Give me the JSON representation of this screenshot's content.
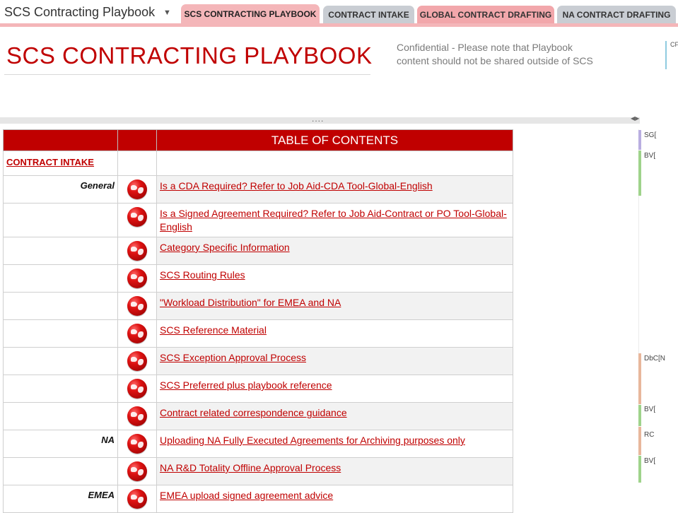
{
  "notebook": {
    "title": "SCS Contracting Playbook"
  },
  "tabs": [
    {
      "label": "SCS CONTRACTING PLAYBOOK"
    },
    {
      "label": "CONTRACT INTAKE"
    },
    {
      "label": "GLOBAL CONTRACT DRAFTING"
    },
    {
      "label": "NA CONTRACT DRAFTING"
    }
  ],
  "page": {
    "title": "SCS CONTRACTING PLAYBOOK",
    "confidential_line1": "Confidential - Please note that Playbook",
    "confidential_line2": "content should not be shared outside of SCS",
    "right_note": "CF"
  },
  "margin_tags": [
    "SG[",
    "BV[",
    "DbC[N",
    "BV[",
    "RC",
    "BV["
  ],
  "colors": {
    "accent": "#c00000",
    "tab_band": "#f4b6b9"
  },
  "toc": {
    "header": "TABLE OF CONTENTS",
    "section": "CONTRACT INTAKE",
    "rows": [
      {
        "category": "General",
        "link": "Is a CDA Required? Refer to Job Aid-CDA Tool-Global-English",
        "icon": "globe-icon"
      },
      {
        "category": "",
        "link": "Is a Signed Agreement Required? Refer to Job Aid-Contract or PO Tool-Global-English",
        "icon": "globe-icon"
      },
      {
        "category": "",
        "link": "Category Specific Information",
        "icon": "globe-icon"
      },
      {
        "category": "",
        "link": "SCS Routing Rules",
        "icon": "globe-icon"
      },
      {
        "category": "",
        "link": "\"Workload Distribution\" for EMEA and NA",
        "icon": "globe-icon"
      },
      {
        "category": "",
        "link": "SCS Reference Material",
        "icon": "globe-icon"
      },
      {
        "category": "",
        "link": "SCS Exception Approval Process",
        "icon": "globe-icon"
      },
      {
        "category": "",
        "link": "SCS Preferred plus playbook reference",
        "icon": "globe-icon"
      },
      {
        "category": "",
        "link": "Contract related correspondence guidance",
        "icon": "globe-icon"
      },
      {
        "category": "NA",
        "link": "Uploading NA Fully Executed Agreements for Archiving purposes only",
        "icon": "globe-icon"
      },
      {
        "category": "",
        "link": "NA R&D Totality Offline Approval Process",
        "icon": "globe-icon"
      },
      {
        "category": "EMEA",
        "link": "EMEA upload signed agreement advice",
        "icon": "globe-icon"
      }
    ]
  }
}
